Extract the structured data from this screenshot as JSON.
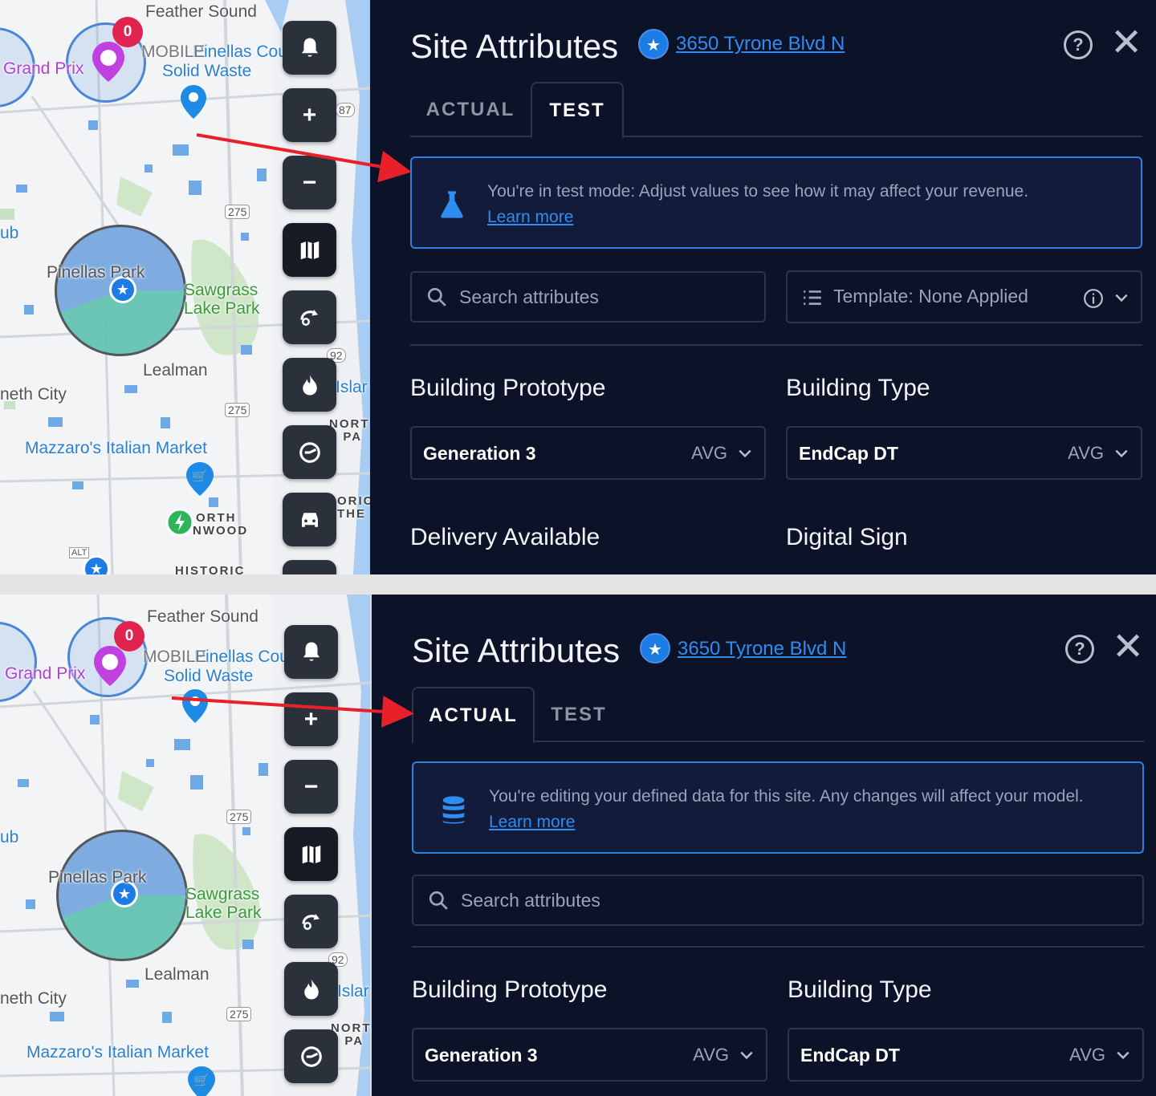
{
  "map": {
    "labels": {
      "feather_sound": "Feather Sound",
      "pinellas_county": "Pinellas Count",
      "mobile_overlay": "MOBILE",
      "solid_waste": "Solid Waste",
      "grand_prix": "Grand Prix",
      "ub": "ub",
      "pinellas_park": "Pinellas Park",
      "sawgrass": "Sawgrass",
      "lake_park": "Lake Park",
      "lealman": "Lealman",
      "kenneth_city": "neth City",
      "mazzaros": "Mazzaro's Italian Market",
      "island": "Islar",
      "north_pa": "NORT",
      "north_pa2": "T PA",
      "orth": "ORTH",
      "nwood": "NWOOD",
      "historic": "HISTORIC",
      "oric": "ORIC",
      "the": "THE",
      "hwy_275": "275",
      "hwy_92": "92",
      "hwy_87": "87",
      "alt": "ALT"
    },
    "badge_count": "0",
    "buttons": [
      "bell-icon",
      "plus-icon",
      "minus-icon",
      "map-icon",
      "route-icon",
      "fire-icon",
      "gauge-icon",
      "car-icon"
    ]
  },
  "panel": {
    "title": "Site Attributes",
    "address": "3650 Tyrone Blvd N",
    "help_icon": "?",
    "close_icon": "✕",
    "tabs": [
      "ACTUAL",
      "TEST"
    ],
    "test_notice": "You're in test mode: Adjust values to see how it may affect your revenue.",
    "actual_notice": "You're editing your defined data for this site. Any changes will affect your model.",
    "learn_more": "Learn more",
    "search_placeholder": "Search attributes",
    "template_label": "Template: None Applied",
    "fields": {
      "building_prototype": {
        "label": "Building Prototype",
        "value": "Generation 3",
        "tag": "AVG"
      },
      "building_type": {
        "label": "Building Type",
        "value": "EndCap DT",
        "tag": "AVG"
      },
      "delivery_available": {
        "label": "Delivery Available"
      },
      "digital_sign": {
        "label": "Digital Sign"
      }
    }
  },
  "colors": {
    "panel_bg": "#0c1228",
    "accent": "#2f8cf0",
    "arrow": "#e8202a",
    "badge": "#e0244f"
  }
}
